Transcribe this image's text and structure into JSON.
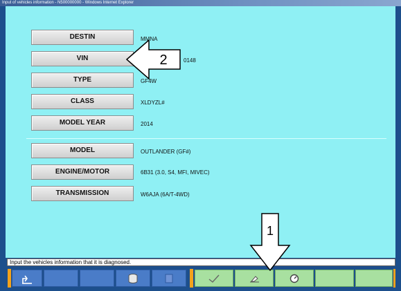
{
  "window": {
    "title": "Input of vehicles information - N500000000 - Windows Internet Explorer"
  },
  "fields": [
    {
      "label": "DESTIN",
      "value": "MMNA"
    },
    {
      "label": "VIN",
      "value": "0148"
    },
    {
      "label": "TYPE",
      "value": "GF4W"
    },
    {
      "label": "CLASS",
      "value": "XLDYZL#"
    },
    {
      "label": "MODEL YEAR",
      "value": "2014"
    },
    {
      "label": "MODEL",
      "value": "OUTLANDER (GF#)"
    },
    {
      "label": "ENGINE/MOTOR",
      "value": "6B31 (3.0, S4, MFI, MIVEC)"
    },
    {
      "label": "TRANSMISSION",
      "value": "W6AJA (6A/T-4WD)"
    }
  ],
  "status": {
    "text": "Input the vehicles information that it is diagnosed."
  },
  "toolbar": {
    "icons": [
      "back-icon",
      "database-icon",
      "help-icon",
      "confirm-icon",
      "eraser-icon",
      "history-icon"
    ]
  },
  "callouts": {
    "one": "1",
    "two": "2"
  },
  "colors": {
    "content_bg": "#8ff0f4",
    "frame": "#1d4f8c",
    "separator": "#f3a21b"
  }
}
